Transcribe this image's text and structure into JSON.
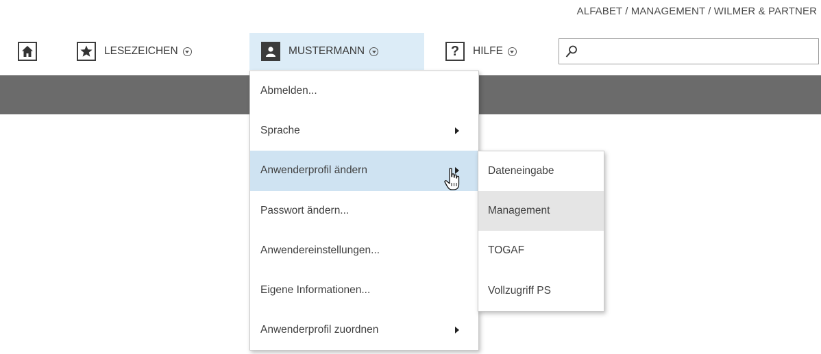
{
  "breadcrumb": "ALFABET / MANAGEMENT / WILMER & PARTNER",
  "toolbar": {
    "home_icon": "home-icon",
    "bookmarks_label": "LESEZEICHEN",
    "user_label": "MUSTERMANN",
    "help_label": "HILFE",
    "search_value": "",
    "search_placeholder": ""
  },
  "user_menu": {
    "items": [
      {
        "label": "Abmelden..."
      },
      {
        "label": "Sprache",
        "has_submenu": true
      },
      {
        "label": "Anwenderprofil ändern",
        "has_submenu": true,
        "active": true
      },
      {
        "label": "Passwort ändern..."
      },
      {
        "label": "Anwendereinstellungen..."
      },
      {
        "label": "Eigene Informationen..."
      },
      {
        "label": "Anwenderprofil zuordnen",
        "has_submenu": true
      }
    ]
  },
  "profile_submenu": {
    "items": [
      {
        "label": "Dateneingabe"
      },
      {
        "label": "Management",
        "hover": true
      },
      {
        "label": "TOGAF"
      },
      {
        "label": "Vollzugriff PS"
      }
    ]
  },
  "colors": {
    "active_menu_bg": "#cfe3f2",
    "user_button_bg": "#dcecf7",
    "dark_bar": "#6b6b6b",
    "submenu_hover": "#e5e5e5"
  }
}
